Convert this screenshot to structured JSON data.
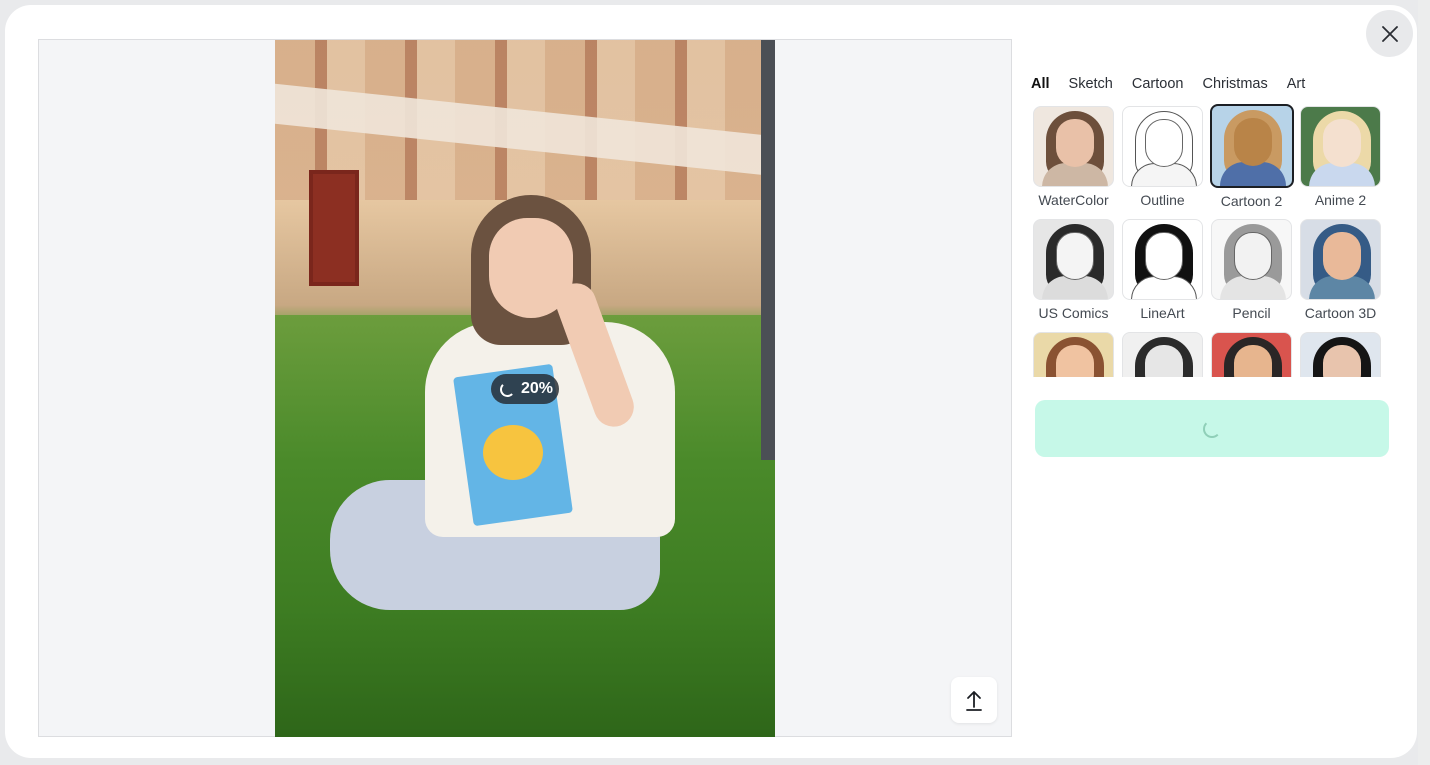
{
  "dialog": {
    "close_label": "Close",
    "progress_percent": "20%"
  },
  "upload": {
    "label": "Upload"
  },
  "tabs": [
    {
      "label": "All",
      "active": true
    },
    {
      "label": "Sketch",
      "active": false
    },
    {
      "label": "Cartoon",
      "active": false
    },
    {
      "label": "Christmas",
      "active": false
    },
    {
      "label": "Art",
      "active": false
    }
  ],
  "styles": [
    {
      "label": "WaterColor",
      "selected": false,
      "bg": "#efe7df",
      "hair": "#6d4f3b",
      "skin": "#e9c1a8",
      "body": "#cdb7a4"
    },
    {
      "label": "Outline",
      "selected": false,
      "bg": "#ffffff",
      "hair": "#ffffff",
      "skin": "#ffffff",
      "body": "#f5f5f5"
    },
    {
      "label": "Cartoon 2",
      "selected": true,
      "bg": "#b7d3e8",
      "hair": "#c99a62",
      "skin": "#b98448",
      "body": "#4f6fa8"
    },
    {
      "label": "Anime 2",
      "selected": false,
      "bg": "#4c7a4a",
      "hair": "#ecd9a8",
      "skin": "#f4e0cf",
      "body": "#c9d8ee"
    },
    {
      "label": "US Comics",
      "selected": false,
      "bg": "#e6e6e6",
      "hair": "#2a2a2a",
      "skin": "#f4f4f4",
      "body": "#dcdcdc"
    },
    {
      "label": "LineArt",
      "selected": false,
      "bg": "#ffffff",
      "hair": "#111111",
      "skin": "#ffffff",
      "body": "#ffffff"
    },
    {
      "label": "Pencil",
      "selected": false,
      "bg": "#f7f7f7",
      "hair": "#9a9a9a",
      "skin": "#f2f2f2",
      "body": "#e4e4e4"
    },
    {
      "label": "Cartoon 3D",
      "selected": false,
      "bg": "#d7dde6",
      "hair": "#355b86",
      "skin": "#e9b999",
      "body": "#5d86a5"
    },
    {
      "label": "",
      "selected": false,
      "bg": "#ead9a8",
      "hair": "#8a5232",
      "skin": "#f0c3a1",
      "body": "#d9c090"
    },
    {
      "label": "",
      "selected": false,
      "bg": "#f0f0f0",
      "hair": "#2b2b2b",
      "skin": "#e6e6e6",
      "body": "#cfcfcf"
    },
    {
      "label": "",
      "selected": false,
      "bg": "#d9544e",
      "hair": "#2a2626",
      "skin": "#e7b58e",
      "body": "#c8463f"
    },
    {
      "label": "",
      "selected": false,
      "bg": "#dfe6ee",
      "hair": "#151515",
      "skin": "#e8c4ad",
      "body": "#b9c4d0"
    }
  ],
  "generate": {
    "state": "loading"
  },
  "colors": {
    "generate_bg": "#c6f8e8",
    "canvas_bg": "#f4f5f7",
    "close_bg": "#e8e9eb",
    "progress_pill": "#232830"
  }
}
